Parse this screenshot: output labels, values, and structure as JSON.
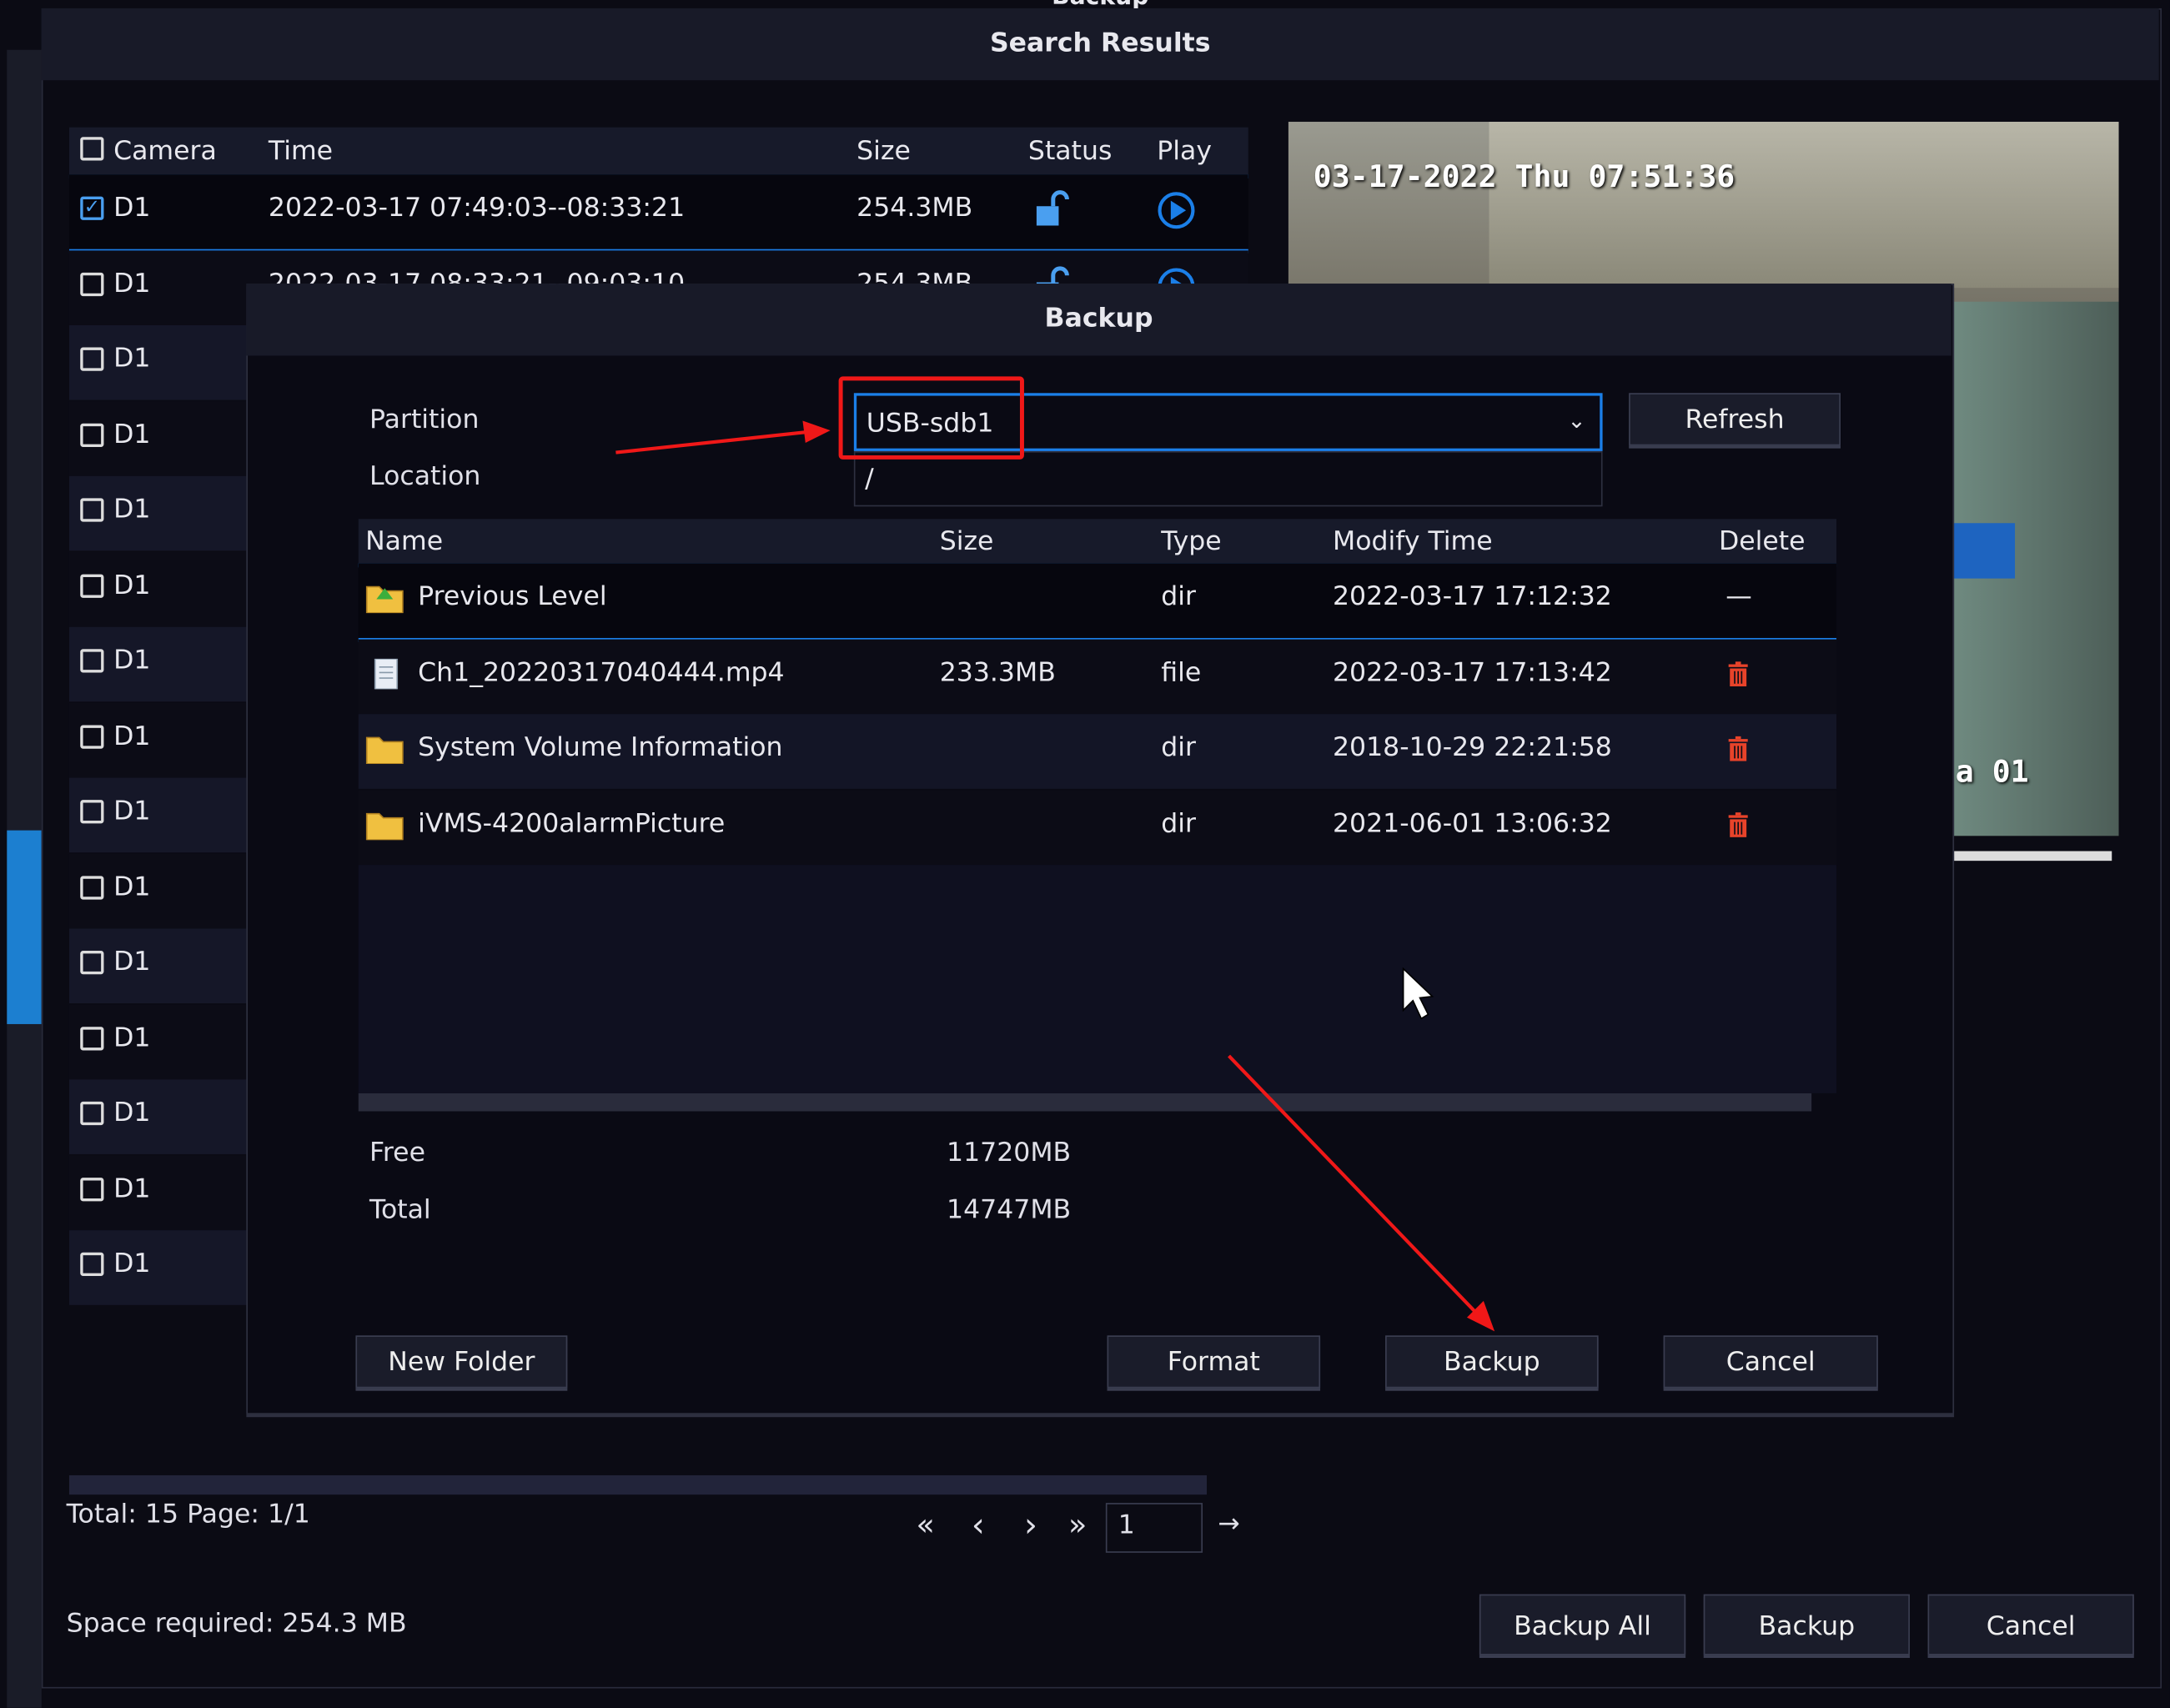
{
  "window": {
    "title": "Search Results",
    "top_clipped_text": "Backup"
  },
  "results_table": {
    "columns": [
      "Camera",
      "Time",
      "Size",
      "Status",
      "Play"
    ],
    "rows": [
      {
        "camera": "D1",
        "time": "2022-03-17 07:49:03--08:33:21",
        "size": "254.3MB",
        "checked": true,
        "status_icon": "unlock-icon",
        "play_icon": "play-circle-icon"
      },
      {
        "camera": "D1",
        "time": "2022-03-17 08:33:21--09:03:10",
        "size": "254.3MB",
        "checked": false
      },
      {
        "camera": "D1",
        "checked": false
      },
      {
        "camera": "D1",
        "checked": false
      },
      {
        "camera": "D1",
        "checked": false
      },
      {
        "camera": "D1",
        "checked": false
      },
      {
        "camera": "D1",
        "checked": false
      },
      {
        "camera": "D1",
        "checked": false
      },
      {
        "camera": "D1",
        "checked": false
      },
      {
        "camera": "D1",
        "checked": false
      },
      {
        "camera": "D1",
        "checked": false
      },
      {
        "camera": "D1",
        "checked": false
      },
      {
        "camera": "D1",
        "checked": false
      },
      {
        "camera": "D1",
        "checked": false
      },
      {
        "camera": "D1",
        "checked": false
      }
    ]
  },
  "preview": {
    "osd_time": "03-17-2022 Thu 07:51:36",
    "osd_camera": "a 01"
  },
  "pagination": {
    "summary": "Total: 15  Page: 1/1",
    "page_input": "1",
    "first": "«",
    "prev": "‹",
    "next": "›",
    "last": "»",
    "go": "→"
  },
  "footer": {
    "space_required": "Space required: 254.3 MB",
    "backup_all": "Backup All",
    "backup": "Backup",
    "cancel": "Cancel"
  },
  "backup_dialog": {
    "title": "Backup",
    "partition_label": "Partition",
    "partition_value": "USB-sdb1",
    "location_label": "Location",
    "location_value": "/",
    "refresh": "Refresh",
    "columns": [
      "Name",
      "Size",
      "Type",
      "Modify Time",
      "Delete"
    ],
    "files": [
      {
        "name": "Previous Level",
        "size": "",
        "type": "dir",
        "modified": "2022-03-17 17:12:32",
        "delete": "—",
        "icon": "folder-up-icon"
      },
      {
        "name": "Ch1_20220317040444.mp4",
        "size": "233.3MB",
        "type": "file",
        "modified": "2022-03-17 17:13:42",
        "icon": "file-icon"
      },
      {
        "name": "System Volume Information",
        "size": "",
        "type": "dir",
        "modified": "2018-10-29 22:21:58",
        "icon": "folder-icon"
      },
      {
        "name": "iVMS-4200alarmPicture",
        "size": "",
        "type": "dir",
        "modified": "2021-06-01 13:06:32",
        "icon": "folder-icon"
      }
    ],
    "free_label": "Free",
    "free_value": "11720MB",
    "total_label": "Total",
    "total_value": "14747MB",
    "new_folder": "New Folder",
    "format": "Format",
    "backup": "Backup",
    "cancel": "Cancel"
  },
  "colors": {
    "accent": "#1b7fe8",
    "annotation": "#f01818",
    "delete": "#e8432a"
  }
}
